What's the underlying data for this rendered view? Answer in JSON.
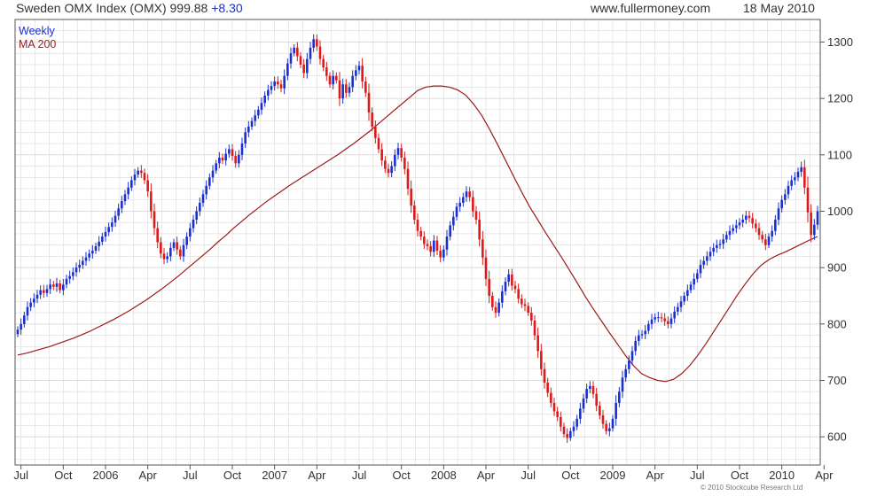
{
  "header": {
    "title": "Sweden OMX Index (OMX) 999.88",
    "change": "+8.30",
    "site": "www.fullermoney.com",
    "date": "18 May 2010"
  },
  "footer": {
    "copyright": "© 2010 Stockcube Research Ltd"
  },
  "chart_data": {
    "type": "candlestick",
    "title": "Sweden OMX Index (OMX)",
    "ylim": [
      550,
      1340
    ],
    "y_ticks": [
      600,
      700,
      800,
      900,
      1000,
      1100,
      1200,
      1300
    ],
    "x_ticks": [
      {
        "label": "Jul",
        "week": 1
      },
      {
        "label": "Oct",
        "week": 14
      },
      {
        "label": "2006",
        "week": 27
      },
      {
        "label": "Apr",
        "week": 40
      },
      {
        "label": "Jul",
        "week": 53
      },
      {
        "label": "Oct",
        "week": 66
      },
      {
        "label": "2007",
        "week": 79
      },
      {
        "label": "Apr",
        "week": 92
      },
      {
        "label": "Jul",
        "week": 105
      },
      {
        "label": "Oct",
        "week": 118
      },
      {
        "label": "2008",
        "week": 131
      },
      {
        "label": "Apr",
        "week": 144
      },
      {
        "label": "Jul",
        "week": 157
      },
      {
        "label": "Oct",
        "week": 170
      },
      {
        "label": "2009",
        "week": 183
      },
      {
        "label": "Apr",
        "week": 196
      },
      {
        "label": "Jul",
        "week": 209
      },
      {
        "label": "Oct",
        "week": 222
      },
      {
        "label": "2010",
        "week": 235
      },
      {
        "label": "Apr",
        "week": 248
      }
    ],
    "grid": true,
    "legend": "top-left",
    "colors": {
      "up": "#1a2fd0",
      "down": "#dd1a1a",
      "ma": "#9b1b1b",
      "grid": "#dadada"
    },
    "series": [
      {
        "name": "Weekly",
        "kind": "ohlc_close",
        "closes": [
          790,
          800,
          815,
          830,
          838,
          845,
          852,
          860,
          855,
          862,
          870,
          866,
          872,
          860,
          870,
          880,
          885,
          892,
          900,
          905,
          912,
          918,
          925,
          930,
          938,
          946,
          955,
          963,
          972,
          980,
          992,
          1005,
          1018,
          1030,
          1042,
          1055,
          1065,
          1072,
          1068,
          1055,
          1035,
          1000,
          970,
          945,
          925,
          915,
          920,
          935,
          945,
          932,
          920,
          940,
          955,
          970,
          985,
          1000,
          1015,
          1030,
          1045,
          1060,
          1072,
          1085,
          1095,
          1090,
          1102,
          1110,
          1098,
          1085,
          1100,
          1120,
          1140,
          1150,
          1160,
          1170,
          1180,
          1192,
          1205,
          1215,
          1222,
          1230,
          1225,
          1218,
          1240,
          1262,
          1280,
          1290,
          1275,
          1260,
          1245,
          1270,
          1290,
          1305,
          1292,
          1270,
          1255,
          1240,
          1225,
          1240,
          1232,
          1200,
          1225,
          1210,
          1220,
          1240,
          1250,
          1258,
          1230,
          1210,
          1175,
          1150,
          1130,
          1110,
          1090,
          1075,
          1068,
          1080,
          1100,
          1112,
          1095,
          1075,
          1040,
          1010,
          985,
          965,
          955,
          942,
          938,
          928,
          948,
          930,
          918,
          932,
          955,
          975,
          990,
          1008,
          1015,
          1025,
          1035,
          1025,
          1000,
          985,
          950,
          918,
          880,
          850,
          830,
          820,
          838,
          858,
          875,
          888,
          868,
          862,
          845,
          835,
          832,
          820,
          806,
          780,
          752,
          720,
          696,
          678,
          660,
          645,
          635,
          618,
          605,
          598,
          610,
          618,
          632,
          650,
          668,
          685,
          690,
          676,
          655,
          638,
          623,
          610,
          615,
          632,
          660,
          680,
          705,
          720,
          735,
          752,
          770,
          780,
          782,
          788,
          800,
          808,
          812,
          812,
          810,
          805,
          800,
          810,
          822,
          830,
          840,
          850,
          860,
          870,
          880,
          890,
          905,
          912,
          920,
          928,
          935,
          940,
          942,
          950,
          958,
          965,
          970,
          975,
          980,
          985,
          992,
          988,
          978,
          970,
          958,
          950,
          940,
          955,
          965,
          985,
          1005,
          1020,
          1030,
          1045,
          1055,
          1060,
          1070,
          1078,
          1042,
          998,
          958,
          976,
          999.88
        ]
      },
      {
        "name": "MA 200",
        "kind": "line",
        "values": [
          745,
          748,
          752,
          756,
          760,
          765,
          770,
          775,
          781,
          787,
          794,
          801,
          808,
          816,
          824,
          833,
          842,
          852,
          862,
          873,
          884,
          896,
          908,
          920,
          932,
          945,
          957,
          970,
          982,
          994,
          1005,
          1016,
          1026,
          1036,
          1046,
          1055,
          1064,
          1073,
          1082,
          1091,
          1100,
          1110,
          1120,
          1131,
          1142,
          1154,
          1166,
          1178,
          1190,
          1202,
          1214,
          1220,
          1222,
          1222,
          1220,
          1215,
          1206,
          1190,
          1170,
          1145,
          1118,
          1090,
          1062,
          1034,
          1008,
          985,
          962,
          940,
          918,
          895,
          872,
          848,
          826,
          805,
          784,
          764,
          744,
          726,
          712,
          705,
          700,
          698,
          702,
          712,
          726,
          744,
          764,
          786,
          808,
          830,
          852,
          872,
          890,
          905,
          915,
          922,
          928,
          935,
          942,
          949,
          955
        ]
      }
    ]
  }
}
